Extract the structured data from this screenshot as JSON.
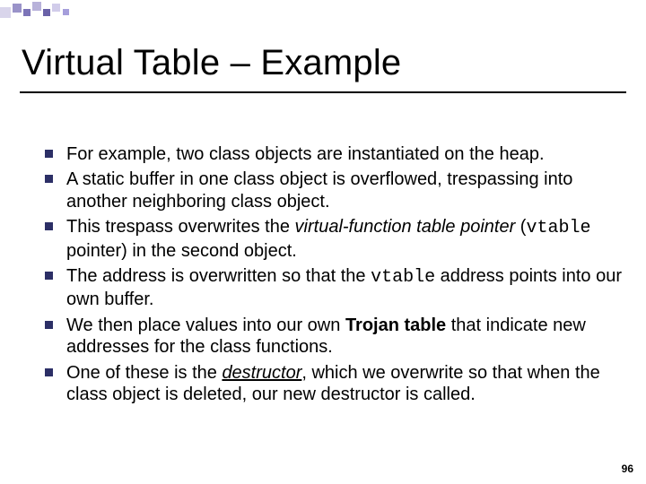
{
  "title": "Virtual Table  – Example",
  "bullets": {
    "b1": "For example, two class objects are instantiated on the heap.",
    "b2": "A static buffer in one class object is overflowed, trespassing into another neighboring class object.",
    "b3a": "This trespass overwrites the ",
    "b3b": "virtual-function table pointer",
    "b3c": " (",
    "b3d": "vtable",
    "b3e": " pointer) in the second object.",
    "b4a": "The address is overwritten so that the ",
    "b4b": "vtable",
    "b4c": " address points into our own buffer.",
    "b5a": "We then place values into our own ",
    "b5b": "Trojan table",
    "b5c": " that indicate new addresses for the class functions.",
    "b6a": "One of these is the ",
    "b6b": "destructor",
    "b6c": ", which we overwrite so that when the class object is deleted, our new destructor is called."
  },
  "page_number": "96"
}
